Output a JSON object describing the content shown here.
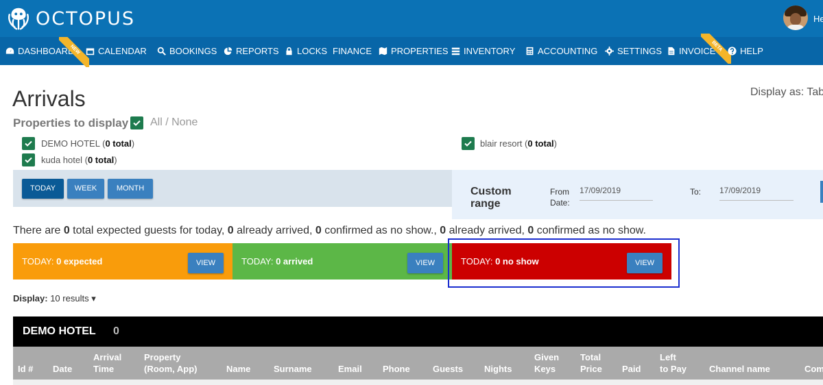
{
  "app": {
    "logo_text": "OCTOPUS",
    "user_greeting": "He"
  },
  "nav": [
    {
      "label": "DASHBOARD",
      "icon": "dashboard-icon"
    },
    {
      "label": "CALENDAR",
      "icon": "calendar-icon"
    },
    {
      "label": "BOOKINGS",
      "icon": "search-icon"
    },
    {
      "label": "REPORTS",
      "icon": "pie-chart-icon"
    },
    {
      "label": "LOCKS",
      "icon": "lock-icon"
    },
    {
      "label": "FINANCE",
      "icon": ""
    },
    {
      "label": "PROPERTIES",
      "icon": "map-icon"
    },
    {
      "label": "INVENTORY",
      "icon": "list-icon"
    },
    {
      "label": "ACCOUNTING",
      "icon": "calculator-icon"
    },
    {
      "label": "SETTINGS",
      "icon": "gear-icon"
    },
    {
      "label": "INVOICE",
      "icon": "document-icon"
    },
    {
      "label": "HELP",
      "icon": "question-icon"
    }
  ],
  "ribbons": {
    "new": "NEW",
    "beta": "BETA"
  },
  "page": {
    "title": "Arrivals",
    "display_as": "Display as: Tab",
    "properties_label": "Properties to display",
    "all_none": "All / None"
  },
  "properties": [
    {
      "name": "DEMO HOTEL",
      "open": " (",
      "total": "0 total",
      "close": ")"
    },
    {
      "name": "kuda hotel",
      "open": " (",
      "total": "0 total",
      "close": ")"
    },
    {
      "name": "blair resort",
      "open": " (",
      "total": "0 total",
      "close": ")"
    }
  ],
  "range": {
    "buttons": [
      "TODAY",
      "WEEK",
      "MONTH"
    ],
    "custom_label_1": "Custom",
    "custom_label_2": "range",
    "from_label_1": "From",
    "from_label_2": "Date:",
    "from_value": "17/09/2019",
    "to_label": "To:",
    "to_value": "17/09/2019"
  },
  "summary": {
    "t1": "There are ",
    "n1": "0",
    "t2": " total expected guests for today, ",
    "n2": "0",
    "t3": " already arrived, ",
    "n3": "0",
    "t4": " confirmed as no show., ",
    "n4": "0",
    "t5": " already arrived, ",
    "n5": "0",
    "t6": " confirmed as no show."
  },
  "cards": [
    {
      "prefix": "TODAY: ",
      "value": "0 expected",
      "button": "VIEW",
      "color": "#f99c0b"
    },
    {
      "prefix": "TODAY: ",
      "value": "0 arrived",
      "button": "VIEW",
      "color": "#5cb747"
    },
    {
      "prefix": "TODAY: ",
      "value": "0 no show",
      "button": "VIEW",
      "color": "#cc0000"
    }
  ],
  "display": {
    "label": "Display:",
    "value": "10 results",
    "caret": "▾"
  },
  "hotel": {
    "name": "DEMO HOTEL",
    "count": "0",
    "columns": [
      [
        "",
        "Id #"
      ],
      [
        "",
        "Date"
      ],
      [
        "Arrival",
        "Time"
      ],
      [
        "Property",
        "(Room, App)"
      ],
      [
        "",
        "Name"
      ],
      [
        "",
        "Surname"
      ],
      [
        "",
        "Email"
      ],
      [
        "",
        "Phone"
      ],
      [
        "",
        "Guests"
      ],
      [
        "",
        "Nights"
      ],
      [
        "Given",
        "Keys"
      ],
      [
        "Total",
        "Price"
      ],
      [
        "",
        "Paid"
      ],
      [
        "Left",
        "to Pay"
      ],
      [
        "",
        "Channel name"
      ],
      [
        "",
        "Com"
      ]
    ]
  },
  "colors": {
    "topbar": "#0b72b5",
    "navbar": "#0866a8",
    "checkbox": "#1e7b4e",
    "button": "#3a80bf"
  }
}
